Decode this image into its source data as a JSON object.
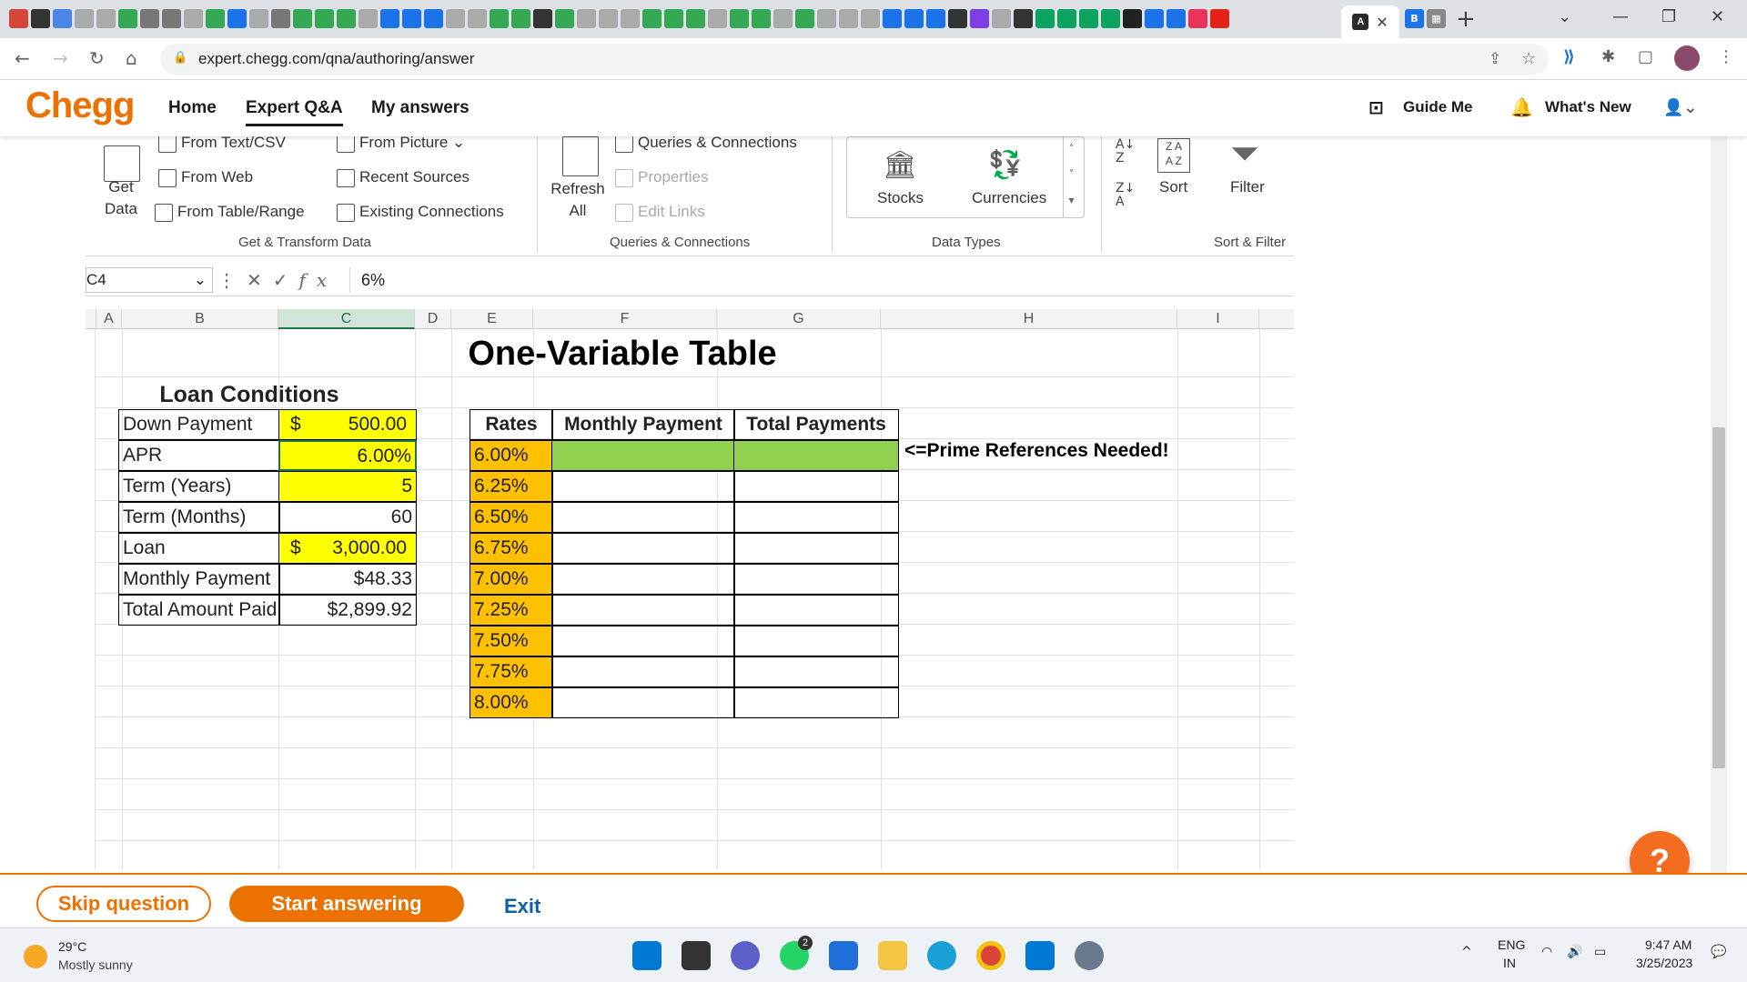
{
  "browser": {
    "url": "expert.chegg.com/qna/authoring/answer",
    "tab_icon_colors": [
      "#d44638",
      "#333",
      "#4a86e8",
      "#aaa",
      "#aaa",
      "#34a853",
      "#777",
      "#777",
      "#aaa",
      "#34a853",
      "#1a73e8",
      "#aaa",
      "#777",
      "#34a853",
      "#34a853",
      "#34a853",
      "#aaa",
      "#1a73e8",
      "#1a73e8",
      "#1a73e8",
      "#aaa",
      "#aaa",
      "#34a853",
      "#34a853",
      "#333",
      "#34a853",
      "#aaa",
      "#aaa",
      "#aaa",
      "#34a853",
      "#34a853",
      "#34a853",
      "#aaa",
      "#34a853",
      "#34a853",
      "#aaa",
      "#34a853",
      "#aaa",
      "#aaa",
      "#aaa",
      "#1a73e8",
      "#1a73e8",
      "#1a73e8",
      "#333",
      "#7b3fe4",
      "#aaa",
      "#333",
      "#0ba360",
      "#0ba360",
      "#0ba360",
      "#0ba360",
      "#222",
      "#1a73e8",
      "#1a73e8",
      "#e8335a",
      "#e62117",
      "#e62117",
      "#e62117",
      "#e62117",
      "#999"
    ],
    "active_tab_icon": "A",
    "after_tab_icons": [
      "B",
      "▦"
    ]
  },
  "chegg": {
    "logo": "Chegg",
    "nav": {
      "home": "Home",
      "expert": "Expert Q&A",
      "answers": "My answers"
    },
    "guide_me": "Guide Me",
    "whats_new": "What's New"
  },
  "ribbon": {
    "get_data": "Get\nData",
    "from_text": "From Text/CSV",
    "from_web": "From Web",
    "from_table": "From Table/Range",
    "from_picture": "From Picture",
    "recent_sources": "Recent Sources",
    "existing_connections": "Existing Connections",
    "refresh_all": "Refresh\nAll",
    "queries_connections": "Queries & Connections",
    "properties": "Properties",
    "edit_links": "Edit Links",
    "stocks": "Stocks",
    "currencies": "Currencies",
    "sort": "Sort",
    "filter": "Filter",
    "group_get_transform": "Get & Transform Data",
    "group_queries": "Queries & Connections",
    "group_data_types": "Data Types",
    "group_sort_filter": "Sort & Filter"
  },
  "formula_bar": {
    "name_box": "C4",
    "formula": "6%"
  },
  "columns": [
    "A",
    "B",
    "C",
    "D",
    "E",
    "F",
    "G",
    "H",
    "I"
  ],
  "sheet": {
    "title": "One-Variable Table",
    "loan_header": "Loan Conditions",
    "loan_rows": [
      {
        "label": "Down Payment",
        "prefix": "$",
        "value": "500.00"
      },
      {
        "label": "APR",
        "prefix": "",
        "value": "6.00%"
      },
      {
        "label": "Term (Years)",
        "prefix": "",
        "value": "5"
      },
      {
        "label": "Term (Months)",
        "prefix": "",
        "value": "60"
      },
      {
        "label": "Loan",
        "prefix": "$",
        "value": "3,000.00"
      },
      {
        "label": "Monthly Payment",
        "prefix": "",
        "value": "$48.33"
      },
      {
        "label": "Total Amount Paid",
        "prefix": "",
        "value": "$2,899.92"
      }
    ],
    "table_headers": {
      "rates": "Rates",
      "monthly": "Monthly Payment",
      "total": "Total Payments"
    },
    "rates": [
      "6.00%",
      "6.25%",
      "6.50%",
      "6.75%",
      "7.00%",
      "7.25%",
      "7.50%",
      "7.75%",
      "8.00%"
    ],
    "note": "<=Prime References Needed!"
  },
  "actions": {
    "skip": "Skip question",
    "start": "Start answering",
    "exit": "Exit"
  },
  "help": "?",
  "taskbar": {
    "temp": "29°C",
    "weather": "Mostly sunny",
    "lang1": "ENG",
    "lang2": "IN",
    "time": "9:47 AM",
    "date": "3/25/2023",
    "whatsapp_badge": "2"
  }
}
